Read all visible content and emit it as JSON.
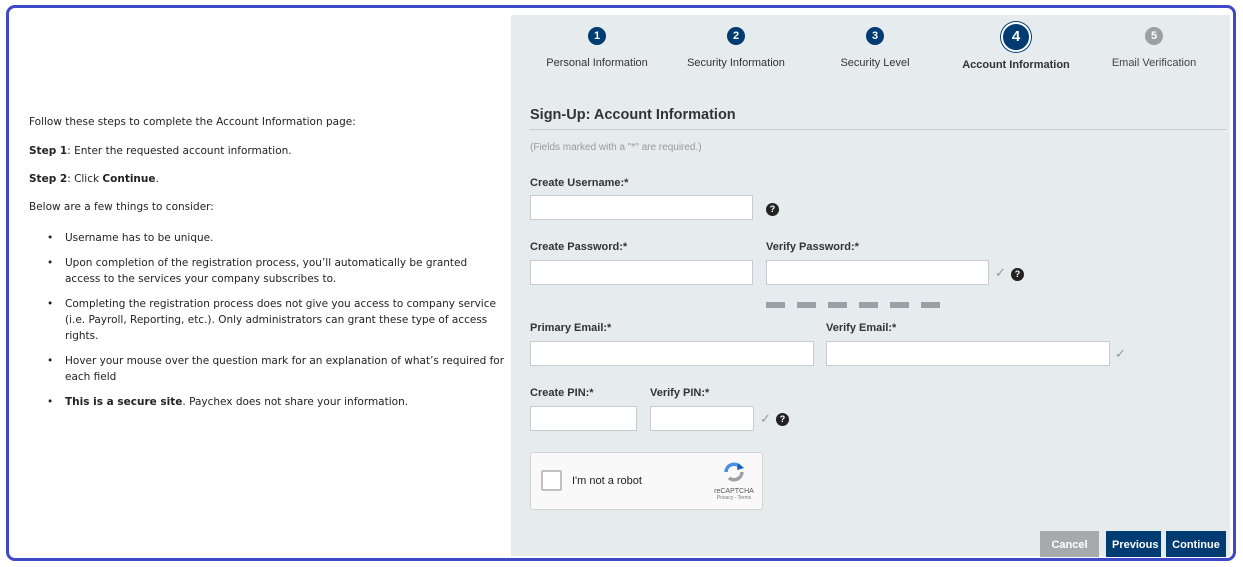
{
  "instructions": {
    "intro": "Follow these steps to complete the Account Information page:",
    "step1_label": "Step 1",
    "step1_text": ": Enter the requested account information.",
    "step2_label": "Step 2",
    "step2_text": ": Click ",
    "step2_bold": "Continue",
    "step2_end": ".",
    "consider": "Below are a few things to consider:",
    "bullets": [
      "Username has to be unique.",
      "Upon completion of the registration process, you’ll automatically be granted access to the services your company subscribes to.",
      "Completing the registration process does not give you access to company service (i.e. Payroll, Reporting, etc.). Only administrators can grant these type of access rights.",
      "Hover your mouse over the question mark for an explanation of what’s required for each field"
    ],
    "last_bullet_bold": "This is a secure site",
    "last_bullet_text": ". Paychex does not share your information."
  },
  "steps": [
    {
      "num": "1",
      "label": "Personal Information"
    },
    {
      "num": "2",
      "label": "Security Information"
    },
    {
      "num": "3",
      "label": "Security Level"
    },
    {
      "num": "4",
      "label": "Account Information"
    },
    {
      "num": "5",
      "label": "Email Verification"
    }
  ],
  "form": {
    "title": "Sign-Up: Account Information",
    "required_note": "(Fields marked with a \"*\" are required.)",
    "username_label": "Create Username:*",
    "password_label": "Create Password:*",
    "verify_password_label": "Verify Password:*",
    "primary_email_label": "Primary Email:*",
    "verify_email_label": "Verify Email:*",
    "pin_label": "Create PIN:*",
    "verify_pin_label": "Verify PIN:*",
    "username_value": "",
    "password_value": "",
    "verify_password_value": "",
    "primary_email_value": "",
    "verify_email_value": "",
    "pin_value": "",
    "verify_pin_value": ""
  },
  "captcha": {
    "label": "I'm not a robot",
    "brand": "reCAPTCHA",
    "terms": "Privacy - Terms"
  },
  "buttons": {
    "cancel": "Cancel",
    "previous": "Previous",
    "continue": "Continue"
  },
  "colors": {
    "primary": "#003b71",
    "cancel": "#a7aaad",
    "panel": "#e6ebee",
    "frame": "#3d49c8"
  },
  "icons": {
    "help": "question-circle-icon",
    "check": "checkmark-icon"
  }
}
